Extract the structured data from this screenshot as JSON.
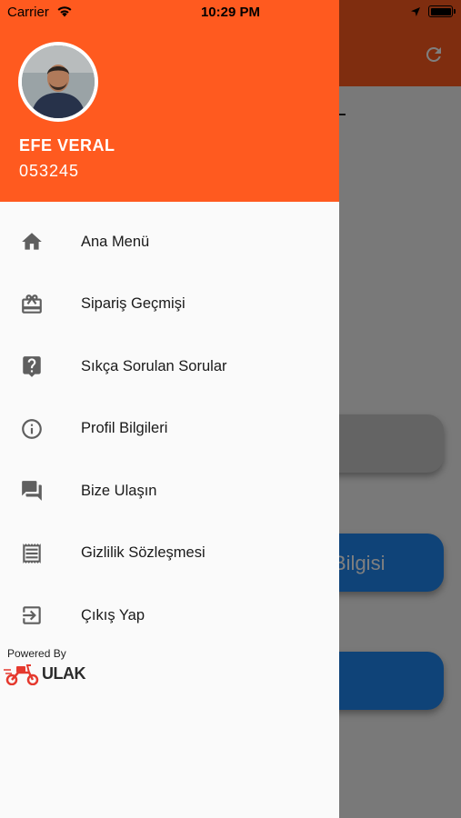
{
  "status_bar": {
    "carrier": "Carrier",
    "time": "10:29 PM"
  },
  "user": {
    "name": "EFE VERAL",
    "id": "053245"
  },
  "menu": [
    {
      "label": "Ana Menü",
      "icon": "home-icon"
    },
    {
      "label": "Sipariş Geçmişi",
      "icon": "gift-card-icon"
    },
    {
      "label": "Sıkça Sorulan Sorular",
      "icon": "help-icon"
    },
    {
      "label": "Profil Bilgileri",
      "icon": "info-icon"
    },
    {
      "label": "Bize Ulaşın",
      "icon": "forum-icon"
    },
    {
      "label": "Gizlilik Sözleşmesi",
      "icon": "receipt-icon"
    },
    {
      "label": "Çıkış Yap",
      "icon": "exit-icon"
    }
  ],
  "footer": {
    "powered_by": "Powered By",
    "brand": "ULAK"
  },
  "background": {
    "button_label": "Bilgisi"
  },
  "colors": {
    "accent": "#ff5a1f",
    "button_blue": "#1f86f0"
  }
}
